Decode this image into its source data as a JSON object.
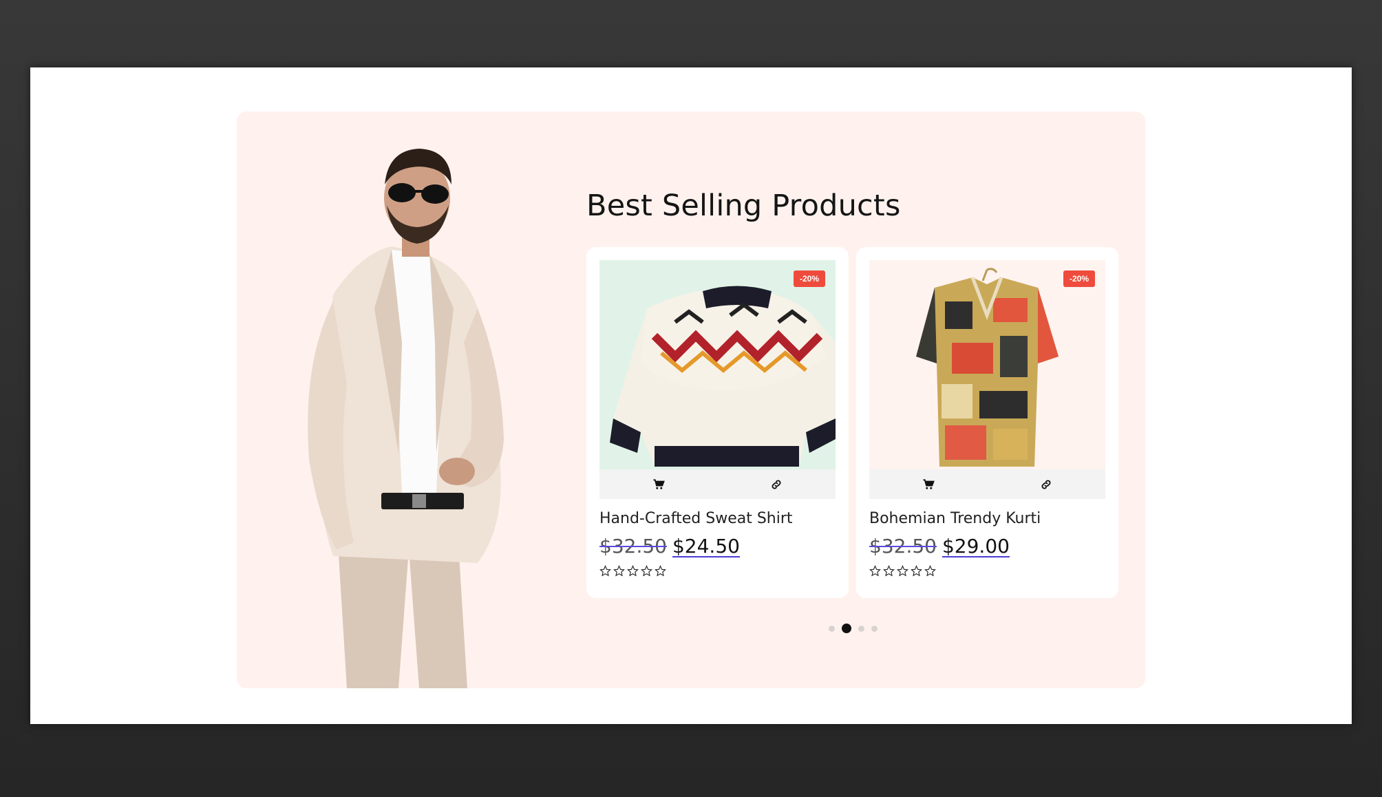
{
  "section": {
    "title": "Best Selling Products"
  },
  "products": [
    {
      "name": "Hand-Crafted Sweat Shirt",
      "old_price": "$32.50",
      "new_price": "$24.50",
      "badge": "-20%",
      "rating": 0,
      "image_icon": "knit-sweater",
      "image_bg": "#e1f3e8"
    },
    {
      "name": "Bohemian Trendy Kurti",
      "old_price": "$32.50",
      "new_price": "$29.00",
      "badge": "-20%",
      "rating": 0,
      "image_icon": "patterned-shirt",
      "image_bg": "#fff3f0"
    }
  ],
  "actions": {
    "cart_icon": "cart-icon",
    "link_icon": "link-icon"
  },
  "pagination": {
    "total": 4,
    "active": 1
  },
  "colors": {
    "section_bg": "#fff2ee",
    "badge_bg": "#ef4b3d",
    "price_underline": "#4a3cd6"
  }
}
